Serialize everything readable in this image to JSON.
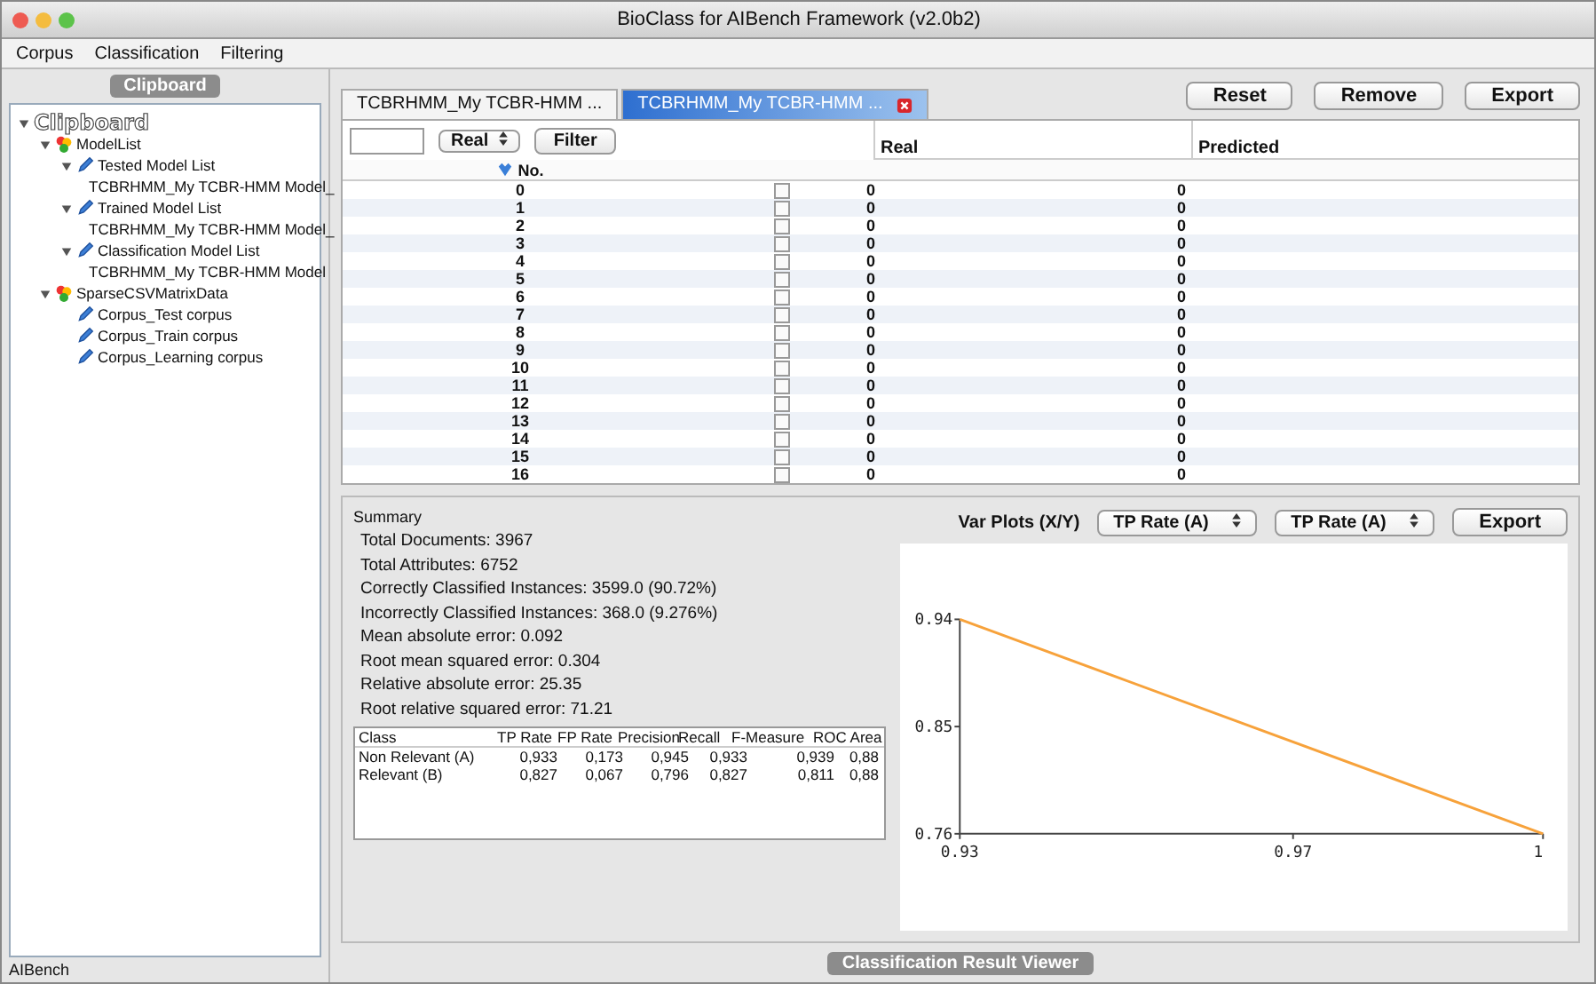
{
  "window": {
    "title": "BioClass for AIBench Framework (v2.0b2)"
  },
  "menu": [
    "Corpus",
    "Classification",
    "Filtering"
  ],
  "sidebar": {
    "header": "Clipboard",
    "tree": [
      {
        "label": "Clipboard",
        "kind": "root",
        "expanded": true,
        "children": [
          {
            "label": "ModelList",
            "kind": "datatype",
            "expanded": true,
            "children": [
              {
                "label": "Tested Model List",
                "kind": "item",
                "expanded": true,
                "children": [
                  {
                    "label": "TCBRHMM_My TCBR-HMM Model_",
                    "kind": "item"
                  }
                ]
              },
              {
                "label": "Trained Model List",
                "kind": "item",
                "expanded": true,
                "children": [
                  {
                    "label": "TCBRHMM_My TCBR-HMM Model_",
                    "kind": "item"
                  }
                ]
              },
              {
                "label": "Classification Model List",
                "kind": "item",
                "expanded": true,
                "children": [
                  {
                    "label": "TCBRHMM_My TCBR-HMM Model",
                    "kind": "item"
                  }
                ]
              }
            ]
          },
          {
            "label": "SparseCSVMatrixData",
            "kind": "datatype",
            "expanded": true,
            "children": [
              {
                "label": "Corpus_Test corpus",
                "kind": "item"
              },
              {
                "label": "Corpus_Train corpus",
                "kind": "item"
              },
              {
                "label": "Corpus_Learning corpus",
                "kind": "item"
              }
            ]
          }
        ]
      }
    ]
  },
  "tabs": [
    {
      "label": "TCBRHMM_My TCBR-HMM ...",
      "selected": false,
      "closable": false
    },
    {
      "label": "TCBRHMM_My TCBR-HMM ...",
      "selected": true,
      "closable": true
    }
  ],
  "actions": [
    "Reset",
    "Remove",
    "Export"
  ],
  "table": {
    "type_select": "Real",
    "filter_button": "Filter",
    "no_header": "No.",
    "real_header": "Real",
    "predicted_header": "Predicted",
    "rows": [
      {
        "no": "0",
        "checked": false,
        "real": "0",
        "predicted": "0"
      },
      {
        "no": "1",
        "checked": false,
        "real": "0",
        "predicted": "0"
      },
      {
        "no": "2",
        "checked": false,
        "real": "0",
        "predicted": "0"
      },
      {
        "no": "3",
        "checked": false,
        "real": "0",
        "predicted": "0"
      },
      {
        "no": "4",
        "checked": false,
        "real": "0",
        "predicted": "0"
      },
      {
        "no": "5",
        "checked": false,
        "real": "0",
        "predicted": "0"
      },
      {
        "no": "6",
        "checked": false,
        "real": "0",
        "predicted": "0"
      },
      {
        "no": "7",
        "checked": false,
        "real": "0",
        "predicted": "0"
      },
      {
        "no": "8",
        "checked": false,
        "real": "0",
        "predicted": "0"
      },
      {
        "no": "9",
        "checked": false,
        "real": "0",
        "predicted": "0"
      },
      {
        "no": "10",
        "checked": false,
        "real": "0",
        "predicted": "0"
      },
      {
        "no": "11",
        "checked": false,
        "real": "0",
        "predicted": "0"
      },
      {
        "no": "12",
        "checked": false,
        "real": "0",
        "predicted": "0"
      },
      {
        "no": "13",
        "checked": false,
        "real": "0",
        "predicted": "0"
      },
      {
        "no": "14",
        "checked": false,
        "real": "0",
        "predicted": "0"
      },
      {
        "no": "15",
        "checked": false,
        "real": "0",
        "predicted": "0"
      },
      {
        "no": "16",
        "checked": false,
        "real": "0",
        "predicted": "0"
      }
    ]
  },
  "summary": {
    "title": "Summary",
    "lines": [
      "Total Documents: 3967",
      "Total Attributes: 6752",
      "Correctly Classified Instances: 3599.0 (90.72%)",
      "Incorrectly Classified Instances: 368.0 (9.276%)",
      "Mean absolute error: 0.092",
      "Root mean squared error: 0.304",
      "Relative absolute error: 25.35",
      "Root relative squared error: 71.21"
    ],
    "class_table": {
      "columns": [
        "Class",
        "TP Rate",
        "FP Rate",
        "Precision",
        "Recall",
        "F-Measure",
        "ROC Area"
      ],
      "rows": [
        [
          "Non Relevant (A)",
          "0,933",
          "0,173",
          "0,945",
          "0,933",
          "0,939",
          "0,88"
        ],
        [
          "Relevant (B)",
          "0,827",
          "0,067",
          "0,796",
          "0,827",
          "0,811",
          "0,88"
        ]
      ]
    }
  },
  "plot": {
    "label": "Var Plots (X/Y)",
    "x_select": "TP Rate (A)",
    "y_select": "TP Rate (A)",
    "export": "Export",
    "chart_data": {
      "type": "line",
      "x": [
        0.93,
        1
      ],
      "series": [
        {
          "color": "#f7a23b",
          "values": [
            0.94,
            0.76
          ]
        }
      ],
      "xlim": [
        0.93,
        1
      ],
      "ylim": [
        0.76,
        0.94
      ],
      "xticks": [
        0.93,
        0.97,
        1
      ],
      "yticks": [
        0.76,
        0.85,
        0.94
      ]
    }
  },
  "bottom_tab": "Classification Result Viewer",
  "status_bar": "AIBench"
}
